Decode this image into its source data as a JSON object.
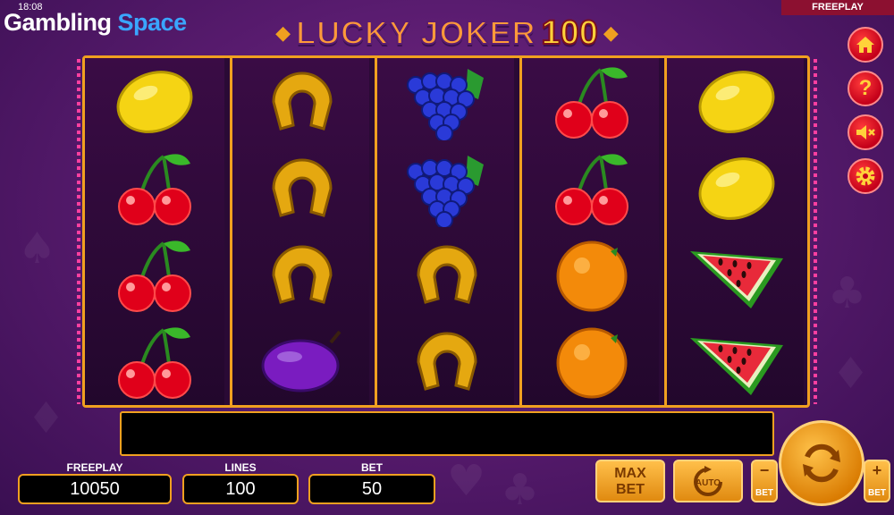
{
  "status_bar": {
    "time": "18:08"
  },
  "branding": {
    "word1": "Gambling",
    "word2": "Space"
  },
  "mode_tag": "FREEPLAY",
  "game_title": {
    "part1": "LUCKY JOKER",
    "part2": "100"
  },
  "side_menu": [
    {
      "name": "home",
      "icon": "home-icon"
    },
    {
      "name": "help",
      "icon": "question-icon",
      "glyph": "?"
    },
    {
      "name": "sound",
      "icon": "speaker-muted-icon"
    },
    {
      "name": "settings",
      "icon": "gear-icon"
    }
  ],
  "reels": [
    [
      "lemon",
      "cherry",
      "cherry",
      "cherry"
    ],
    [
      "horseshoe",
      "horseshoe",
      "horseshoe",
      "plum"
    ],
    [
      "grapes",
      "grapes",
      "horseshoe",
      "horseshoe"
    ],
    [
      "cherry",
      "cherry",
      "orange",
      "orange"
    ],
    [
      "lemon",
      "lemon",
      "watermelon",
      "watermelon"
    ]
  ],
  "message_bar": "",
  "panel": {
    "freeplay_label": "FREEPLAY",
    "freeplay_value": "10050",
    "lines_label": "LINES",
    "lines_value": "100",
    "bet_label": "BET",
    "bet_value": "50"
  },
  "controls": {
    "max_bet_line1": "MAX",
    "max_bet_line2": "BET",
    "auto_label": "AUTO",
    "bet_minus_sign": "−",
    "bet_minus_label": "BET",
    "bet_plus_sign": "+",
    "bet_plus_label": "BET"
  },
  "colors": {
    "frame_gold": "#f0a020",
    "menu_red": "#d0001e",
    "brand_blue": "#3aa6ff"
  }
}
